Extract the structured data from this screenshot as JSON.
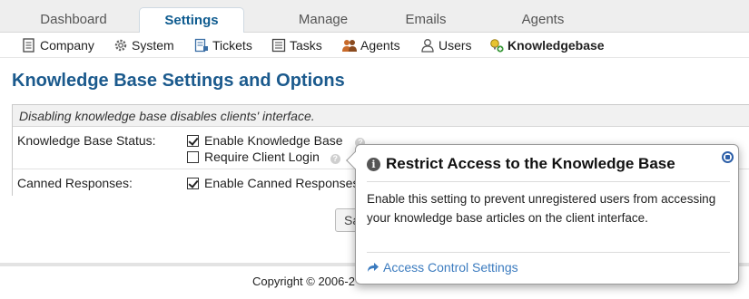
{
  "tabs": [
    {
      "label": "Dashboard",
      "active": false
    },
    {
      "label": "Settings",
      "active": true
    },
    {
      "label": "Manage",
      "active": false
    },
    {
      "label": "Emails",
      "active": false
    },
    {
      "label": "Agents",
      "active": false
    }
  ],
  "subnav": [
    {
      "label": "Company",
      "icon": "company-icon"
    },
    {
      "label": "System",
      "icon": "gear-icon"
    },
    {
      "label": "Tickets",
      "icon": "tickets-icon"
    },
    {
      "label": "Tasks",
      "icon": "tasks-icon"
    },
    {
      "label": "Agents",
      "icon": "agents-icon"
    },
    {
      "label": "Users",
      "icon": "users-icon"
    },
    {
      "label": "Knowledgebase",
      "icon": "knowledgebase-icon",
      "active": true
    }
  ],
  "page": {
    "title": "Knowledge Base Settings and Options"
  },
  "settings": {
    "notice": "Disabling knowledge base disables clients' interface.",
    "rows": [
      {
        "label": "Knowledge Base Status:",
        "options": [
          {
            "label": "Enable Knowledge Base",
            "checked": true
          },
          {
            "label": "Require Client Login",
            "checked": false
          }
        ]
      },
      {
        "label": "Canned Responses:",
        "options": [
          {
            "label": "Enable Canned Responses",
            "checked": true
          }
        ]
      }
    ],
    "save_label": "Save Changes"
  },
  "footer": {
    "text": "Copyright © 2006-2"
  },
  "popup": {
    "title": "Restrict Access to the Knowledge Base",
    "body": "Enable this setting to prevent unregistered users from accessing your knowledge base articles on the client interface.",
    "link": "Access Control Settings"
  },
  "colors": {
    "title_blue": "#1b5a8d",
    "link_blue": "#3b7bbf",
    "close_blue": "#2d5fa8"
  }
}
